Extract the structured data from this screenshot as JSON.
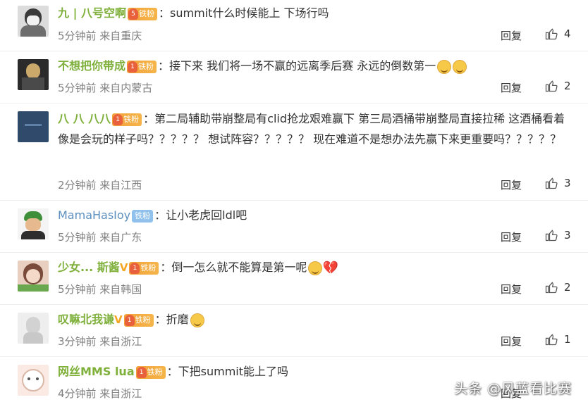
{
  "comments": [
    {
      "username": "九 | 八号空啊",
      "badge_level": "5",
      "badge_text": "铁粉",
      "text": "：summit什么时候能上 下场行吗",
      "time": "5分钟前 来自重庆",
      "reply": "回复",
      "likes": "4"
    },
    {
      "username": "不想把你带成",
      "badge_level": "1",
      "badge_text": "铁粉",
      "text": "：接下来 我们将一场不赢的远离季后赛 永远的倒数第一",
      "emoji": [
        "smile-emoji",
        "smile-emoji"
      ],
      "time": "5分钟前 来自内蒙古",
      "reply": "回复",
      "likes": "2"
    },
    {
      "username": "八 八 八八",
      "badge_level": "1",
      "badge_text": "铁粉",
      "text": "：第二局辅助带崩整局有clid抢龙艰难赢下 第三局酒桶带崩整局直接拉稀 这酒桶看着像是会玩的样子吗？？？？？ 想试阵容？？？？？ 现在难道不是想办法先赢下来更重要吗？？？？？",
      "time": "2分钟前 来自江西",
      "reply": "回复",
      "likes": "3"
    },
    {
      "username": "MamaHasIoy",
      "badge_text": "铁粉",
      "text": "：让小老虎回ldl吧",
      "time": "5分钟前 来自广东",
      "reply": "回复",
      "likes": "3"
    },
    {
      "username": "少女... 斯酱",
      "badge_level": "1",
      "badge_text": "铁粉",
      "text": "：倒一怎么就不能算是第一呢",
      "emoji": [
        "smile-emoji",
        "broken-heart-emoji"
      ],
      "time": "5分钟前 来自韩国",
      "reply": "回复",
      "likes": "2"
    },
    {
      "username": "叹嘛北我谦",
      "badge_level": "1",
      "badge_text": "铁粉",
      "text": "：折磨",
      "emoji": [
        "smile-emoji"
      ],
      "time": "3分钟前 来自浙江",
      "reply": "回复",
      "likes": "1"
    },
    {
      "username": "网丝MMS lua",
      "badge_level": "1",
      "badge_text": "铁粉",
      "text": "：下把summit能上了吗",
      "time": "4分钟前 来自浙江",
      "reply": "回复",
      "likes": ""
    }
  ],
  "watermark": "头条 @风蓝看比赛",
  "colors": {
    "username_green": "#7fb03b",
    "badge_orange": "#f2a23a",
    "badge_blue": "#8fc1ec",
    "meta_gray": "#808080"
  }
}
